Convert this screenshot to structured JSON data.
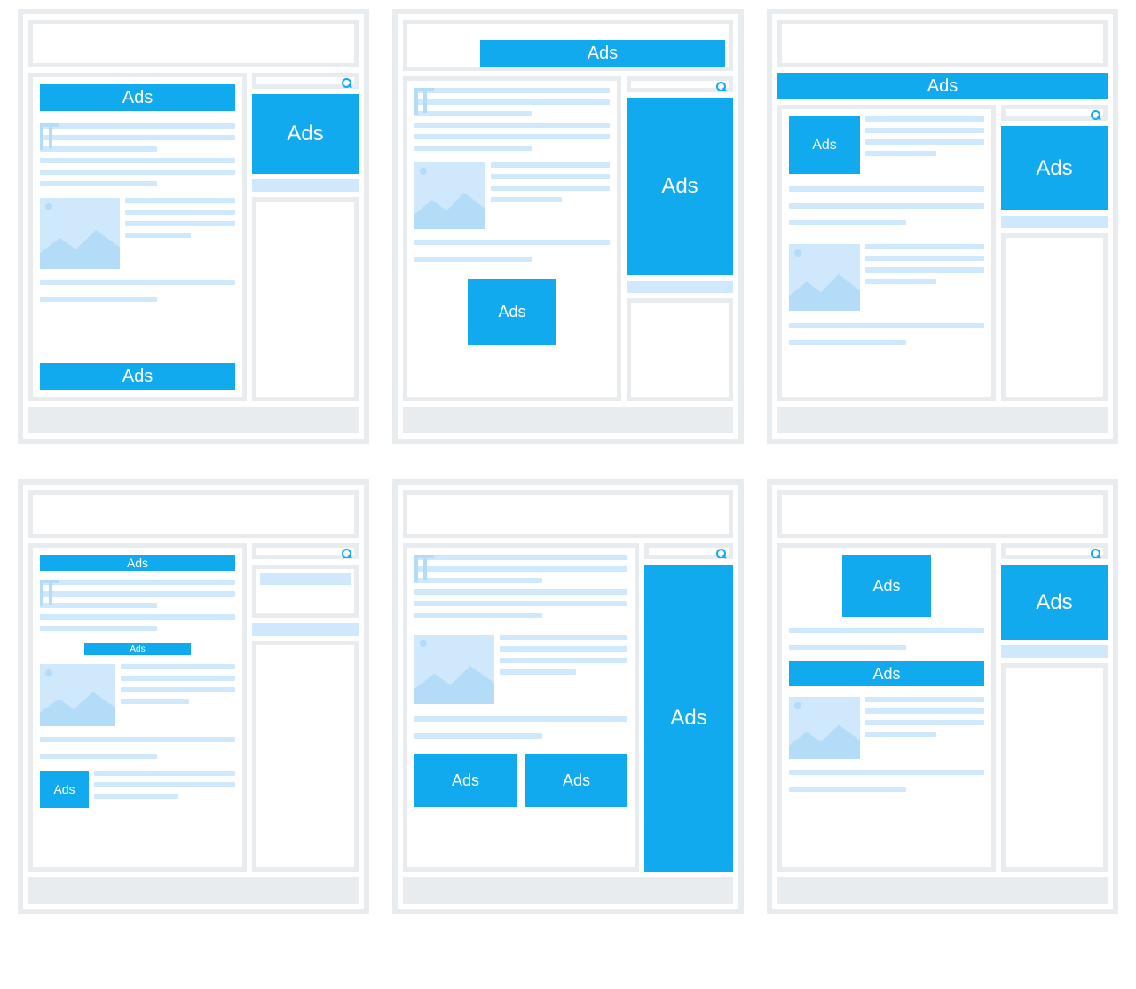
{
  "ad_label": "Ads",
  "layouts": [
    {
      "id": 1,
      "ads": [
        "top-banner",
        "sidebar-rect",
        "bottom-banner"
      ]
    },
    {
      "id": 2,
      "ads": [
        "header-banner",
        "sidebar-skyscraper",
        "inline-square"
      ]
    },
    {
      "id": 3,
      "ads": [
        "full-banner",
        "inline-square",
        "sidebar-rect"
      ]
    },
    {
      "id": 4,
      "ads": [
        "slim-banner",
        "inline-micro",
        "inline-small"
      ]
    },
    {
      "id": 5,
      "ads": [
        "sidebar-tall-skyscraper",
        "inline-square-a",
        "inline-square-b"
      ]
    },
    {
      "id": 6,
      "ads": [
        "inline-square",
        "content-banner",
        "sidebar-rect"
      ]
    }
  ]
}
